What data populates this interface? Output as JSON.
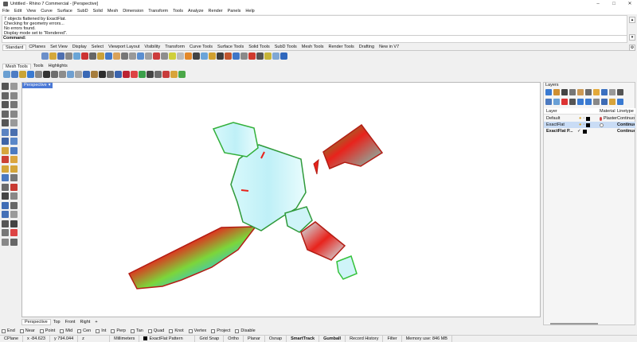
{
  "window": {
    "title": "Untitled - Rhino 7 Commercial - [Perspective]",
    "controls": [
      "–",
      "□",
      "✕"
    ]
  },
  "menu": [
    "File",
    "Edit",
    "View",
    "Curve",
    "Surface",
    "SubD",
    "Solid",
    "Mesh",
    "Dimension",
    "Transform",
    "Tools",
    "Analyze",
    "Render",
    "Panels",
    "Help"
  ],
  "command_history": [
    "7 objects flattened by ExactFlat.",
    "Checking for geometry errors...",
    "No errors found.",
    "Display mode set to \"Rendered\"."
  ],
  "command_prompt": "Command:",
  "toolbar_tabs": [
    "Standard",
    "CPlanes",
    "Set View",
    "Display",
    "Select",
    "Viewport Layout",
    "Visibility",
    "Transform",
    "Curve Tools",
    "Surface Tools",
    "Solid Tools",
    "SubD Tools",
    "Mesh Tools",
    "Render Tools",
    "Drafting",
    "New in V7"
  ],
  "secondary_tabs": [
    "Mesh Tools",
    "Tools",
    "Highlights"
  ],
  "viewport": {
    "title": "Perspective",
    "menu_glyph": "▾"
  },
  "viewport_tabs": [
    "Perspective",
    "Top",
    "Front",
    "Right",
    "+"
  ],
  "osnaps": [
    {
      "label": "End",
      "checked": false
    },
    {
      "label": "Near",
      "checked": false
    },
    {
      "label": "Point",
      "checked": false
    },
    {
      "label": "Mid",
      "checked": false
    },
    {
      "label": "Cen",
      "checked": false
    },
    {
      "label": "Int",
      "checked": false
    },
    {
      "label": "Perp",
      "checked": false
    },
    {
      "label": "Tan",
      "checked": false
    },
    {
      "label": "Quad",
      "checked": false
    },
    {
      "label": "Knot",
      "checked": false
    },
    {
      "label": "Vertex",
      "checked": false
    },
    {
      "label": "Project",
      "checked": false
    },
    {
      "label": "Disable",
      "checked": false
    }
  ],
  "status": {
    "cplane": "CPlane",
    "x": "x -84.623",
    "y": "y 794.044",
    "z": "z",
    "units": "Millimeters",
    "layer": "ExactFlat Pattern",
    "grid_snap": "Grid Snap",
    "ortho": "Ortho",
    "planar": "Planar",
    "osnap": "Osnap",
    "smarttrack": "SmartTrack",
    "gumball": "Gumball",
    "record_history": "Record History",
    "filter": "Filter",
    "memory": "Memory use: 846 MB"
  },
  "layers_panel": {
    "title": "Layers",
    "columns": [
      "Layer",
      "Material",
      "Linetype"
    ],
    "rows": [
      {
        "name": "Default",
        "check": "",
        "material": "Plaster",
        "linetype": "Continuous",
        "color": "#000000",
        "selected": false
      },
      {
        "name": "ExactFlat",
        "check": "",
        "material": "",
        "linetype": "Continuous",
        "color": "#000000",
        "selected": true
      },
      {
        "name": "ExactFlat P...",
        "check": "✓",
        "material": "",
        "linetype": "Continuous",
        "color": "#000000",
        "selected": false
      }
    ]
  },
  "colors": {
    "accent": "#4a78d6",
    "mesh_hot": "#e8231c",
    "mesh_warm": "#35c23a",
    "mesh_cool": "#d8f8fb"
  }
}
